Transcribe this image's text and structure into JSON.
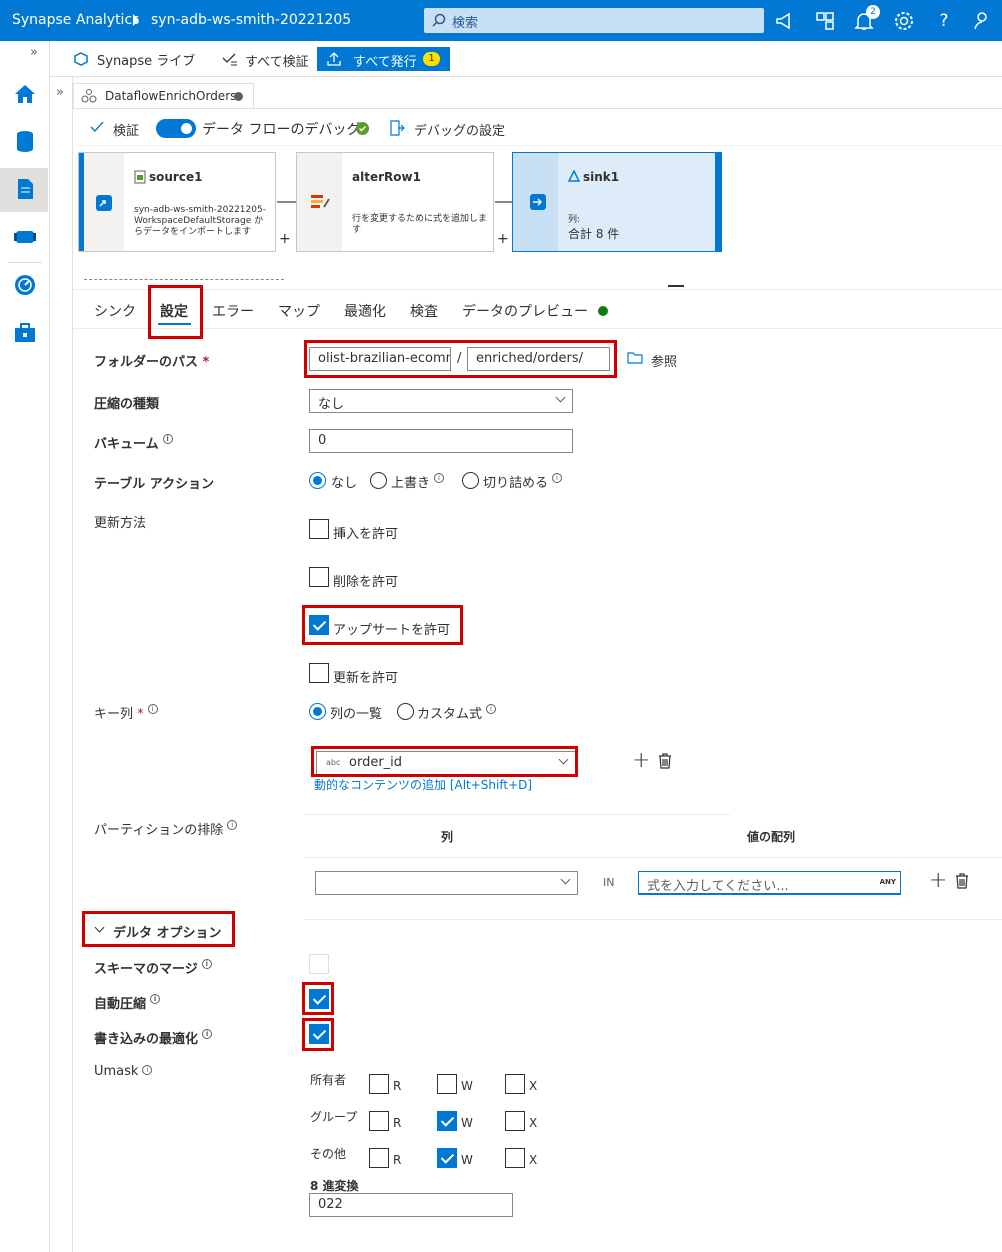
{
  "topbar": {
    "brand": "Synapse Analytics",
    "workspace": "syn-adb-ws-smith-20221205",
    "search_placeholder": "検索",
    "notification_count": "2"
  },
  "toolbar": {
    "synapse_live": "Synapse ライブ",
    "validate_all": "すべて検証",
    "publish_all": "すべて発行",
    "publish_count": "1"
  },
  "editor": {
    "tab_title": "DataflowEnrichOrders",
    "validate": "検証",
    "debug_label": "データ フローのデバッグ",
    "debug_settings": "デバッグの設定"
  },
  "flow": {
    "source": {
      "title": "source1",
      "desc": "syn-adb-ws-smith-20221205-WorkspaceDefaultStorage からデータをインポートします"
    },
    "alter": {
      "title": "alterRow1",
      "desc": "行を変更するために式を追加します"
    },
    "sink": {
      "title": "sink1",
      "cols_label": "列:",
      "cols_value": "合計 8 件"
    }
  },
  "subtabs": {
    "sink": "シンク",
    "settings": "設定",
    "errors": "エラー",
    "mapping": "マップ",
    "optimize": "最適化",
    "inspect": "検査",
    "preview": "データのプレビュー"
  },
  "form": {
    "folder_path_label": "フォルダーのパス",
    "required": "*",
    "folder_container": "olist-brazilian-ecomm",
    "folder_sep": "/",
    "folder_dir": "enriched/orders/",
    "browse": "参照",
    "compression_label": "圧縮の種類",
    "compression_value": "なし",
    "vacuum_label": "バキューム",
    "vacuum_value": "0",
    "table_action_label": "テーブル アクション",
    "ta_none": "なし",
    "ta_overwrite": "上書き",
    "ta_truncate": "切り詰める",
    "update_method_label": "更新方法",
    "allow_insert": "挿入を許可",
    "allow_delete": "削除を許可",
    "allow_upsert": "アップサートを許可",
    "allow_update": "更新を許可",
    "key_cols_label": "キー列",
    "key_list": "列の一覧",
    "key_custom": "カスタム式",
    "key_type_tag": "abc",
    "key_value": "order_id",
    "dynamic_content": "動的なコンテンツの追加 [Alt+Shift+D]",
    "partition_label": "パーティションの排除",
    "col_header": "列",
    "values_header": "値の配列",
    "in_label": "IN",
    "expr_placeholder": "式を入力してください...",
    "any_tag": "ANY",
    "delta_options": "デルタ オプション",
    "schema_merge": "スキーマのマージ",
    "auto_compact": "自動圧縮",
    "optimized_write": "書き込みの最適化",
    "umask_label": "Umask",
    "owner": "所有者",
    "group": "グループ",
    "others": "その他",
    "r": "R",
    "w": "W",
    "x": "X",
    "octal_label": "8 進変換",
    "octal_value": "022"
  },
  "colors": {
    "accent": "#0078d4",
    "highlight": "#d00000",
    "status_green": "#107c10"
  }
}
